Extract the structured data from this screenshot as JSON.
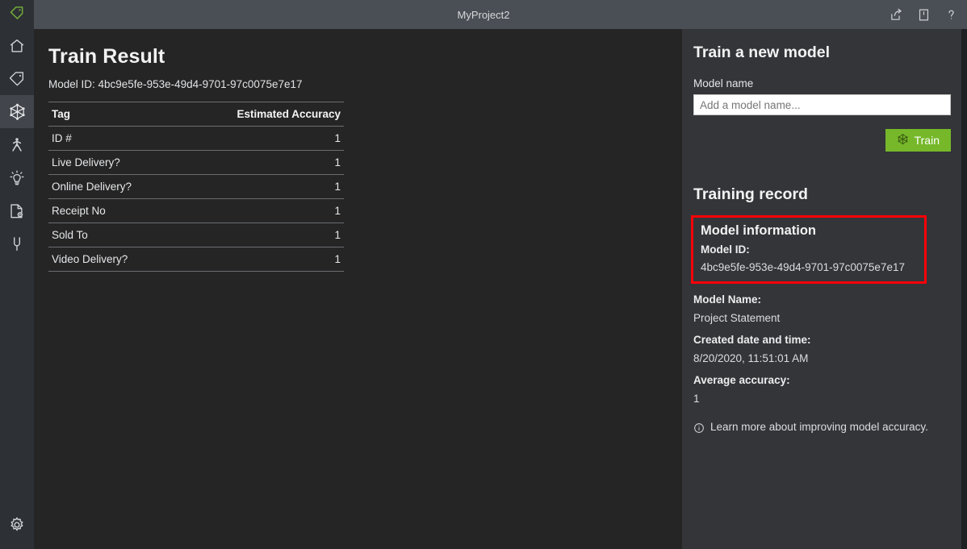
{
  "window": {
    "title": "MyProject2",
    "logo_icon": "tag-icon",
    "actions": [
      {
        "name": "share-icon",
        "label": "Share"
      },
      {
        "name": "book-icon",
        "label": "Documentation"
      },
      {
        "name": "help-icon",
        "label": "?"
      }
    ]
  },
  "sidebar": {
    "items": [
      {
        "name": "home-icon",
        "label": "Home",
        "active": false
      },
      {
        "name": "tag-icon",
        "label": "Tag",
        "active": false
      },
      {
        "name": "model-network-icon",
        "label": "Train",
        "active": true
      },
      {
        "name": "person-icon",
        "label": "Analyze",
        "active": false
      },
      {
        "name": "lightbulb-icon",
        "label": "Insights",
        "active": false
      },
      {
        "name": "document-settings-icon",
        "label": "Document settings",
        "active": false
      },
      {
        "name": "plug-icon",
        "label": "Connections",
        "active": false
      }
    ],
    "bottom": {
      "name": "gear-icon",
      "label": "Settings"
    }
  },
  "main": {
    "page_title": "Train Result",
    "model_id_line": "Model ID: 4bc9e5fe-953e-49d4-9701-97c0075e7e17",
    "table": {
      "headers": [
        "Tag",
        "Estimated Accuracy"
      ],
      "rows": [
        {
          "tag": "ID #",
          "accuracy": "1"
        },
        {
          "tag": "Live Delivery?",
          "accuracy": "1"
        },
        {
          "tag": "Online Delivery?",
          "accuracy": "1"
        },
        {
          "tag": "Receipt No",
          "accuracy": "1"
        },
        {
          "tag": "Sold To",
          "accuracy": "1"
        },
        {
          "tag": "Video Delivery?",
          "accuracy": "1"
        }
      ]
    }
  },
  "side_panel": {
    "train_heading": "Train a new model",
    "model_name_label": "Model name",
    "model_name_value": "",
    "model_name_placeholder": "Add a model name...",
    "train_button_label": "Train",
    "train_button_icon": "model-network-icon",
    "training_record_heading": "Training record",
    "model_information_heading": "Model information",
    "model_id_label": "Model ID:",
    "model_id_value": "4bc9e5fe-953e-49d4-9701-97c0075e7e17",
    "model_name_field_label": "Model Name:",
    "model_name_field_value": "Project Statement",
    "created_label": "Created date and time:",
    "created_value": "8/20/2020, 11:51:01 AM",
    "accuracy_label": "Average accuracy:",
    "accuracy_value": "1",
    "learn_more_text": "Learn more about improving model accuracy.",
    "learn_more_icon": "info-icon"
  },
  "colors": {
    "accent_green": "#76b82a",
    "highlight_red": "#fb0007",
    "titlebar_bg": "#4a4f55",
    "rail_bg": "#2d3034",
    "main_bg": "#252526",
    "side_bg": "#333539"
  }
}
